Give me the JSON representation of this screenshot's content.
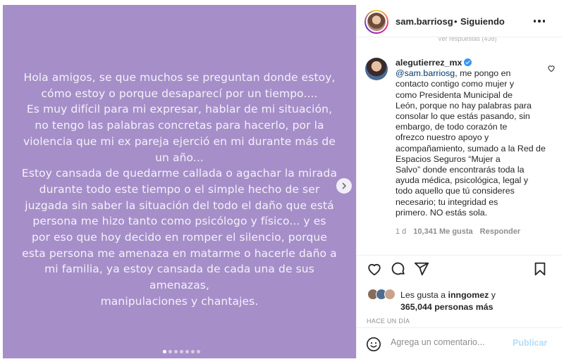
{
  "post": {
    "caption_lines": [
      "Hola amigos, se que muchos se preguntan donde estoy,",
      "cómo estoy o porque desaparecí por un tiempo....",
      "Es muy difícil para mi expresar, hablar de mi situación,",
      "no tengo las palabras concretas para hacerlo, por la",
      "violencia que mi ex pareja ejerció en mi durante más de",
      "un año...",
      "Estoy cansada de quedarme callada o agachar la mirada",
      "durante todo este tiempo o el simple hecho de ser",
      "juzgada sin saber la situación del todo el daño que está",
      "persona me hizo tanto como psicólogo y físico... y es",
      "por eso que hoy decido en romper el silencio, porque",
      "esta persona me amenaza en matarme o hacerle daño a",
      "mi familia, ya estoy cansada de cada una de sus",
      "amenazas,",
      "manipulaciones y chantajes."
    ],
    "background_color": "#a68fc8",
    "carousel_dots": 7,
    "carousel_active_index": 0
  },
  "header": {
    "username": "sam.barriosg",
    "separator": "•",
    "follow_status": "Siguiendo"
  },
  "replies_peek": "Ver respuestas (438)",
  "comment": {
    "username": "alegutierrez_mx",
    "mention": "@sam.barriosg",
    "first_line_rest": ", me pongo en",
    "lines": [
      "contacto contigo como mujer y",
      "como Presidenta Municipal de",
      "León, porque no hay palabras para",
      "consolar lo que estás pasando, sin",
      "embargo, de todo corazón te",
      "ofrezco nuestro apoyo y",
      "acompañamiento, sumado a la Red de",
      "Espacios Seguros “Mujer a",
      "Salvo” donde encontrarás toda la",
      "ayuda médica, psicológica, legal y",
      "todo aquello que tú consideres",
      "necesario; tu integridad es",
      "primero. NO estás sola."
    ],
    "time": "1 d",
    "likes": "10,341 Me gusta",
    "reply_label": "Responder"
  },
  "likes": {
    "prefix": "Les gusta a ",
    "user": "inngomez",
    "conj": " y",
    "count_text": "365,044 personas más"
  },
  "posted_ago": "HACE UN DÍA",
  "add_comment": {
    "placeholder": "Agrega un comentario...",
    "publish_label": "Publicar"
  },
  "icons": [
    "next-icon",
    "more-icon",
    "heart-icon",
    "comment-icon",
    "share-icon",
    "save-icon",
    "emoji-icon",
    "verified-icon"
  ],
  "colors": {
    "link": "#00376b",
    "verified": "#3897f0",
    "publish_disabled": "#b3dbff",
    "muted": "#8e8e8e"
  }
}
